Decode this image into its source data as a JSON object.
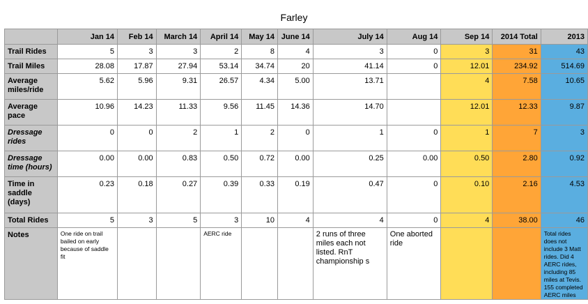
{
  "title": "Farley",
  "columns": [
    "",
    "Jan 14",
    "Feb 14",
    "March 14",
    "April 14",
    "May 14",
    "June 14",
    "July 14",
    "Aug 14",
    "Sep 14",
    "2014 Total",
    "2013"
  ],
  "rows": [
    {
      "label": "Trail Rides",
      "values": [
        "5",
        "3",
        "3",
        "2",
        "8",
        "4",
        "3",
        "0",
        "3",
        "31",
        "43"
      ]
    },
    {
      "label": "Trail Miles",
      "values": [
        "28.08",
        "17.87",
        "27.94",
        "53.14",
        "34.74",
        "20",
        "41.14",
        "0",
        "12.01",
        "234.92",
        "514.69"
      ]
    },
    {
      "label": "Average miles/ride",
      "values": [
        "5.62",
        "5.96",
        "9.31",
        "26.57",
        "4.34",
        "5.00",
        "13.71",
        "",
        "4",
        "7.58",
        "10.65"
      ]
    },
    {
      "label": "Average pace",
      "values": [
        "10.96",
        "14.23",
        "11.33",
        "9.56",
        "11.45",
        "14.36",
        "14.70",
        "",
        "12.01",
        "12.33",
        "9.87"
      ]
    },
    {
      "label": "Dressage rides",
      "values": [
        "0",
        "0",
        "2",
        "1",
        "2",
        "0",
        "1",
        "0",
        "1",
        "7",
        "3"
      ]
    },
    {
      "label": "Dressage time (hours)",
      "values": [
        "0.00",
        "0.00",
        "0.83",
        "0.50",
        "0.72",
        "0.00",
        "0.25",
        "0.00",
        "0.50",
        "2.80",
        "0.92"
      ]
    },
    {
      "label": "Time in saddle (days)",
      "values": [
        "0.23",
        "0.18",
        "0.27",
        "0.39",
        "0.33",
        "0.19",
        "0.47",
        "0",
        "0.10",
        "2.16",
        "4.53"
      ]
    },
    {
      "label": "Total Rides",
      "values": [
        "5",
        "3",
        "5",
        "3",
        "10",
        "4",
        "4",
        "0",
        "4",
        "38.00",
        "46"
      ]
    }
  ],
  "notes": {
    "label": "Notes",
    "jan": "One ride on trail bailed on early because of saddle fit",
    "apr": "AERC ride",
    "jul": "2 runs of three miles each not listed. RnT championship s",
    "aug": "One aborted ride",
    "y2013": "Total rides does not include 3 Matt rides. Did 4 AERC rides, including 85 miles at Tevis. 155 completed AERC miles"
  },
  "colors": {
    "header_grey": "#c8c8c8",
    "sep_yellow": "#ffdd57",
    "total_orange": "#ffa537",
    "y2013_blue": "#5aaee0"
  }
}
